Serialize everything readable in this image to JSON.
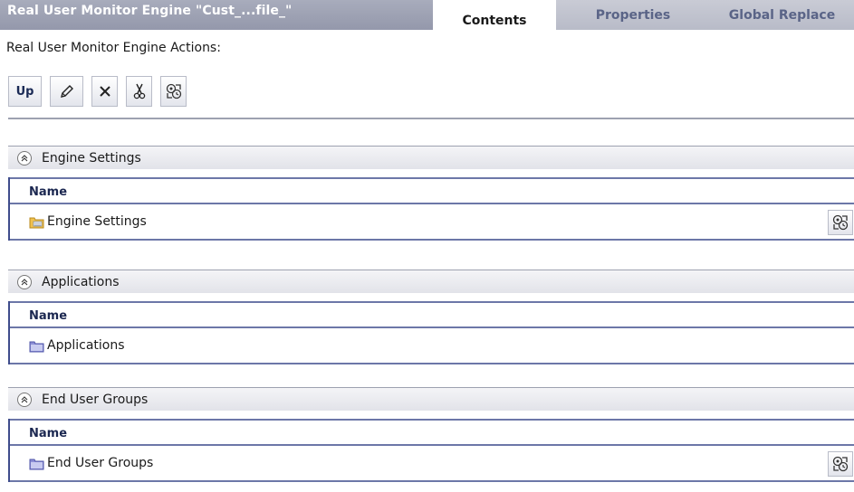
{
  "title": "Real User Monitor Engine \"Cust_...file_\"",
  "tabs": {
    "contents": "Contents",
    "properties": "Properties",
    "global_replace": "Global Replace"
  },
  "actions_label": "Real User Monitor Engine Actions:",
  "toolbar": {
    "up_label": "Up",
    "icons": [
      "pencil-icon",
      "delete-x-icon",
      "scissors-icon",
      "refresh-settings-icon"
    ]
  },
  "sections": [
    {
      "title": "Engine Settings",
      "column_header": "Name",
      "row_label": "Engine Settings",
      "row_icon": "settings-folder-icon",
      "has_action": true
    },
    {
      "title": "Applications",
      "column_header": "Name",
      "row_label": "Applications",
      "row_icon": "folder-icon",
      "has_action": false
    },
    {
      "title": "End User Groups",
      "column_header": "Name",
      "row_label": "End User Groups",
      "row_icon": "folder-icon",
      "has_action": true
    }
  ],
  "colors": {
    "title_bar": "#9ea2b4",
    "tab_inactive_text": "#5a6487",
    "row_border": "#6c77a8",
    "folder_yellow": "#f1c14e",
    "folder_purple": "#8c8fd6"
  }
}
